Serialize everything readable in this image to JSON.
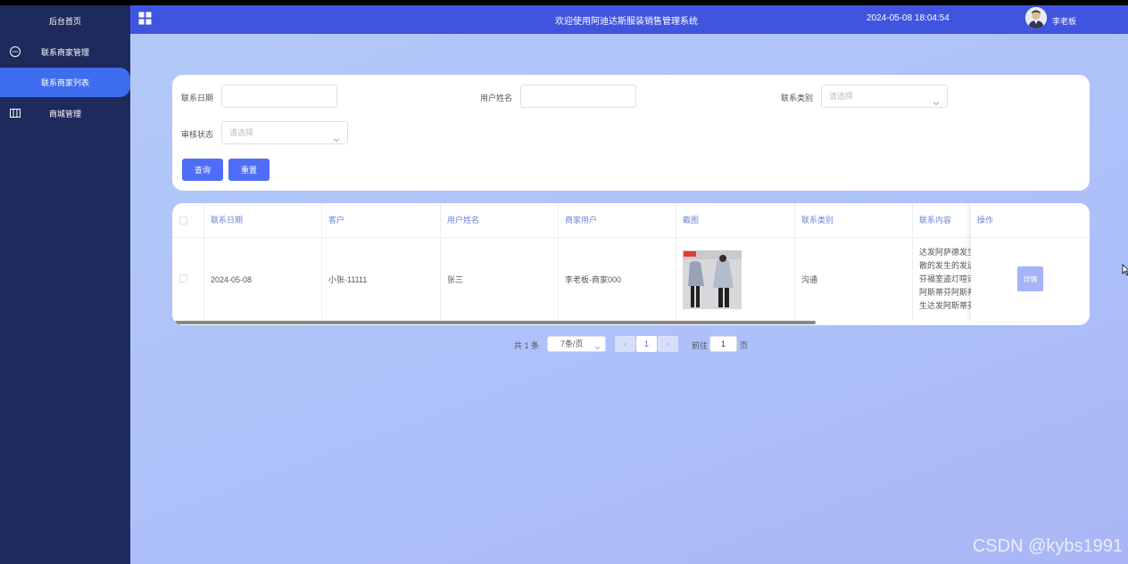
{
  "sidebar": {
    "home": "后台首页",
    "menus": [
      {
        "label": "联系商家管理",
        "icon": "chat-icon"
      },
      {
        "label": "商城管理",
        "icon": "columns-icon"
      }
    ],
    "active_sub": "联系商家列表"
  },
  "header": {
    "title": "欢迎使用阿迪达斯服装销售管理系统",
    "time": "2024-05-08 18:04:54",
    "user": "李老板"
  },
  "filter": {
    "date_label": "联系日期",
    "username_label": "用户姓名",
    "type_label": "联系类别",
    "type_placeholder": "请选择",
    "status_label": "审核状态",
    "status_placeholder": "请选择",
    "search_btn": "查询",
    "reset_btn": "重置"
  },
  "table": {
    "columns": [
      "联系日期",
      "客户",
      "用户姓名",
      "商家用户",
      "截图",
      "联系类别",
      "联系内容",
      "操作"
    ],
    "rows": [
      {
        "date": "2024-05-08",
        "customer": "小张-11111",
        "username": "张三",
        "merchant": "李老板-商家000",
        "type": "沟通",
        "content_lines": [
          "达发阿萨德发生",
          "散的发生的发送",
          "芬福室盗灯喧诺",
          "阿斯蒂芬阿斯蒂",
          "生达发阿斯蒂芬"
        ],
        "action": "详情"
      }
    ]
  },
  "pagination": {
    "total": "共 1 条",
    "page_size": "7条/页",
    "prev": "‹",
    "current": "1",
    "next": "›",
    "goto_label": "前往",
    "goto_value": "1",
    "page_suffix": "页"
  },
  "watermark": "CSDN @kybs1991",
  "colors": {
    "sidebar": "#1f2a5c",
    "header": "#3f55e0",
    "accent": "#4f6ef7"
  }
}
